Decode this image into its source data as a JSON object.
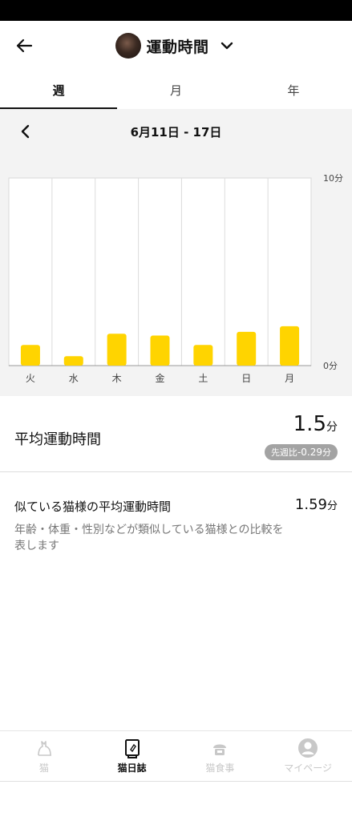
{
  "header": {
    "title": "運動時間"
  },
  "tabs": [
    {
      "label": "週",
      "active": true
    },
    {
      "label": "月",
      "active": false
    },
    {
      "label": "年",
      "active": false
    }
  ],
  "week": {
    "range": "6月11日 - 17日"
  },
  "chart_data": {
    "type": "bar",
    "categories": [
      "火",
      "水",
      "木",
      "金",
      "土",
      "日",
      "月"
    ],
    "values": [
      1.1,
      0.5,
      1.7,
      1.6,
      1.1,
      1.8,
      2.1
    ],
    "ylim": [
      0,
      10
    ],
    "ytick_labels": [
      "10分",
      "0分"
    ],
    "bar_color": "#FFD400",
    "grid": true
  },
  "average": {
    "label": "平均運動時間",
    "value": "1.5",
    "unit": "分",
    "compare_prefix": "先週比",
    "compare_value": "-0.29",
    "compare_unit": "分"
  },
  "similar": {
    "title": "似ている猫様の平均運動時間",
    "value": "1.59",
    "unit": "分",
    "description": "年齢・体重・性別などが類似している猫様との比較を表します"
  },
  "bottom_nav": [
    {
      "label": "猫",
      "icon": "cat-icon",
      "active": false
    },
    {
      "label": "猫日誌",
      "icon": "journal-icon",
      "active": true
    },
    {
      "label": "猫食事",
      "icon": "food-bowl-icon",
      "active": false
    },
    {
      "label": "マイページ",
      "icon": "profile-icon",
      "active": false
    }
  ],
  "colors": {
    "accent": "#FFD400",
    "panel_bg": "#F3F3F3"
  }
}
